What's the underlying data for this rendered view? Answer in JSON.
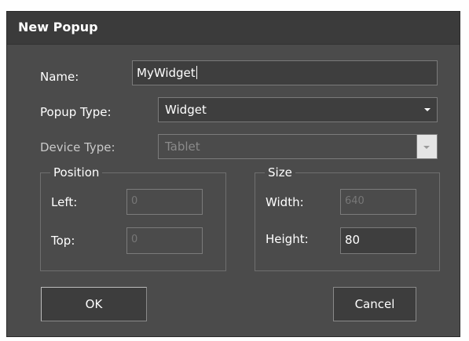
{
  "dialog": {
    "title": "New Popup",
    "ok_label": "OK",
    "cancel_label": "Cancel"
  },
  "fields": {
    "name_label": "Name:",
    "name_value": "MyWidget",
    "popup_type_label": "Popup Type:",
    "popup_type_value": "Widget",
    "device_type_label": "Device Type:",
    "device_type_value": "Tablet"
  },
  "position": {
    "legend": "Position",
    "left_label": "Left:",
    "left_value": "0",
    "top_label": "Top:",
    "top_value": "0"
  },
  "size": {
    "legend": "Size",
    "width_label": "Width:",
    "width_value": "640",
    "height_label": "Height:",
    "height_value": "80"
  },
  "icons": {
    "popup_type_dropdown": "chevron-down-icon",
    "device_type_dropdown": "chevron-down-icon"
  }
}
